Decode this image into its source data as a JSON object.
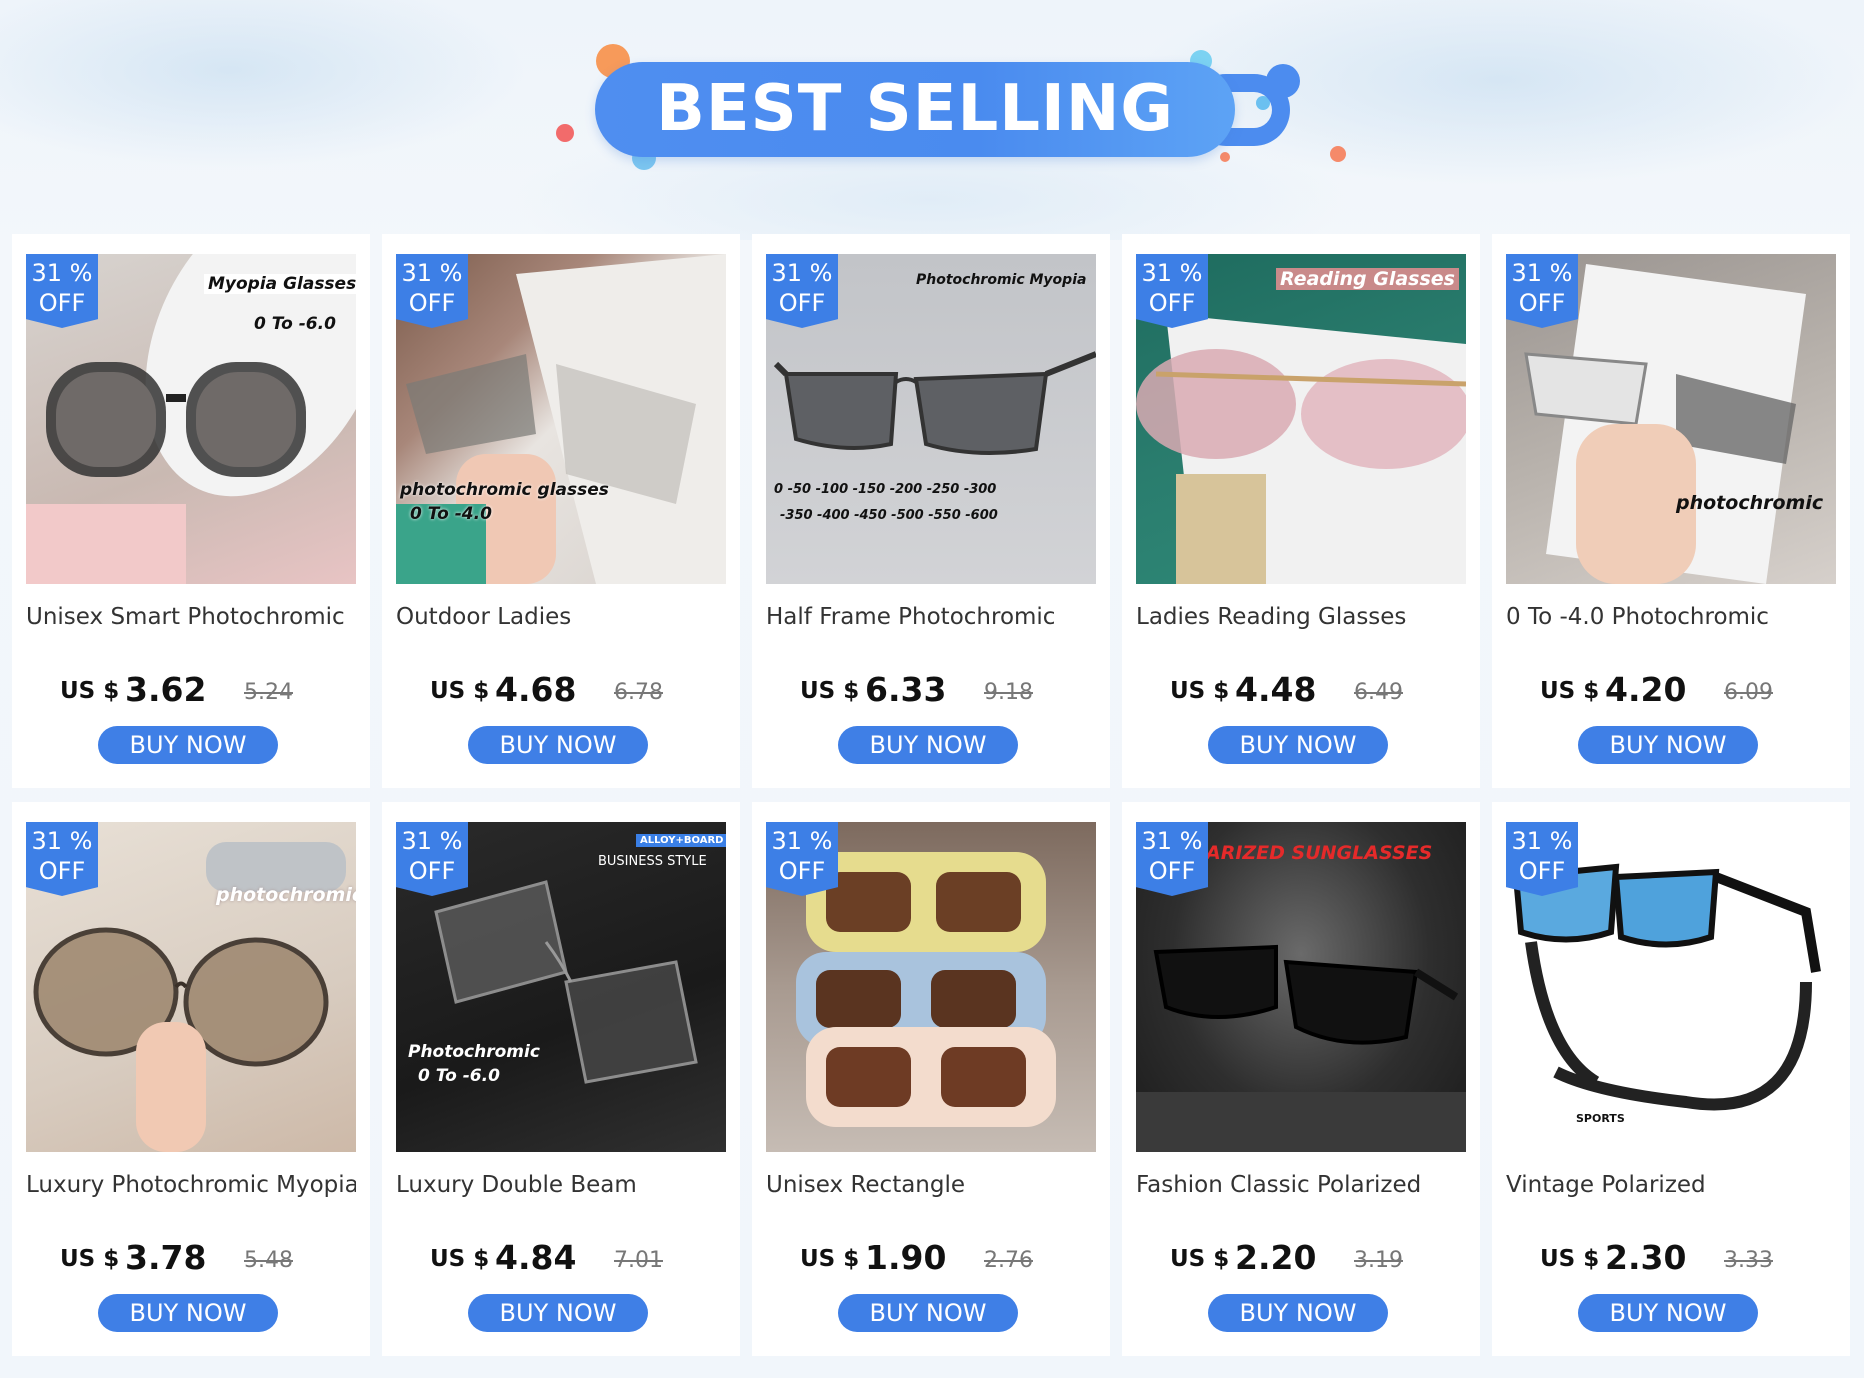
{
  "banner": {
    "title": "BEST SELLING"
  },
  "colors": {
    "accent": "#3d7fe6",
    "banner": "#4f8ef0",
    "card_bg": "#ffffff"
  },
  "products": [
    {
      "badge_pct": "31 %",
      "badge_off": "OFF",
      "image_texts": [
        "Myopia Glasses",
        "0 To -6.0"
      ],
      "title": "Unisex Smart Photochromic",
      "currency": "US $",
      "price": "3.62",
      "old_price": "5.24",
      "button": "BUY NOW"
    },
    {
      "badge_pct": "31 %",
      "badge_off": "OFF",
      "image_texts": [
        "photochromic glasses",
        "0 To -4.0"
      ],
      "title": "Outdoor Ladies",
      "currency": "US $",
      "price": "4.68",
      "old_price": "6.78",
      "button": "BUY NOW"
    },
    {
      "badge_pct": "31 %",
      "badge_off": "OFF",
      "image_texts": [
        "Photochromic Myopia",
        "0 -50 -100 -150 -200 -250 -300",
        "-350 -400 -450 -500 -550 -600"
      ],
      "title": "Half Frame Photochromic",
      "currency": "US $",
      "price": "6.33",
      "old_price": "9.18",
      "button": "BUY NOW"
    },
    {
      "badge_pct": "31 %",
      "badge_off": "OFF",
      "image_texts": [
        "Reading Glasses"
      ],
      "title": "Ladies Reading Glasses",
      "currency": "US $",
      "price": "4.48",
      "old_price": "6.49",
      "button": "BUY NOW"
    },
    {
      "badge_pct": "31 %",
      "badge_off": "OFF",
      "image_texts": [
        "photochromic"
      ],
      "title": "0 To -4.0 Photochromic",
      "currency": "US $",
      "price": "4.20",
      "old_price": "6.09",
      "button": "BUY NOW"
    },
    {
      "badge_pct": "31 %",
      "badge_off": "OFF",
      "image_texts": [
        "photochromic"
      ],
      "title": "Luxury Photochromic Myopia",
      "currency": "US $",
      "price": "3.78",
      "old_price": "5.48",
      "button": "BUY NOW"
    },
    {
      "badge_pct": "31 %",
      "badge_off": "OFF",
      "image_texts": [
        "ALLOY+BOARD",
        "BUSINESS STYLE",
        "Photochromic",
        "0 To -6.0"
      ],
      "title": "Luxury Double Beam",
      "currency": "US $",
      "price": "4.84",
      "old_price": "7.01",
      "button": "BUY NOW"
    },
    {
      "badge_pct": "31 %",
      "badge_off": "OFF",
      "image_texts": [],
      "title": "Unisex Rectangle",
      "currency": "US $",
      "price": "1.90",
      "old_price": "2.76",
      "button": "BUY NOW"
    },
    {
      "badge_pct": "31 %",
      "badge_off": "OFF",
      "image_texts": [
        "ARIZED SUNGLASSES"
      ],
      "title": "Fashion Classic Polarized",
      "currency": "US $",
      "price": "2.20",
      "old_price": "3.19",
      "button": "BUY NOW"
    },
    {
      "badge_pct": "31 %",
      "badge_off": "OFF",
      "image_texts": [
        "SPORTS"
      ],
      "title": "Vintage Polarized",
      "currency": "US $",
      "price": "2.30",
      "old_price": "3.33",
      "button": "BUY NOW"
    }
  ]
}
